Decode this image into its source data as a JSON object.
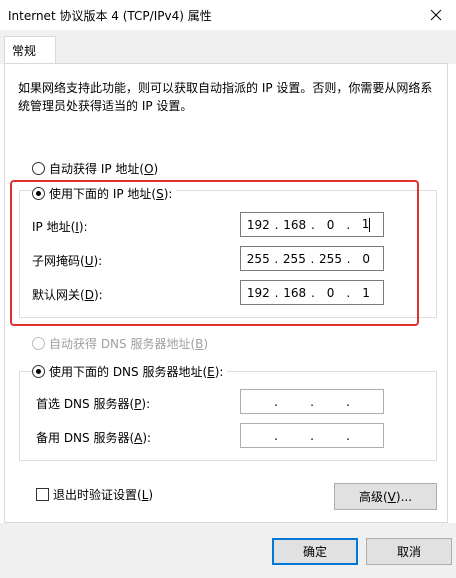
{
  "window": {
    "title": "Internet 协议版本 4 (TCP/IPv4) 属性"
  },
  "tabs": [
    {
      "label": "常规"
    }
  ],
  "description": "如果网络支持此功能，则可以获取自动指派的 IP 设置。否则，你需要从网络系统管理员处获得适当的 IP 设置。",
  "ip_section": {
    "auto_radio": {
      "label": "自动获得 IP 地址(",
      "key": "O",
      "suffix": ")",
      "checked": false
    },
    "manual_radio": {
      "label": "使用下面的 IP 地址(",
      "key": "S",
      "suffix": "):",
      "checked": true
    },
    "fields": [
      {
        "label": "IP 地址(",
        "key": "I",
        "suffix": "):",
        "octets": [
          "192",
          "168",
          "0",
          "1"
        ]
      },
      {
        "label": "子网掩码(",
        "key": "U",
        "suffix": "):",
        "octets": [
          "255",
          "255",
          "255",
          "0"
        ]
      },
      {
        "label": "默认网关(",
        "key": "D",
        "suffix": "):",
        "octets": [
          "192",
          "168",
          "0",
          "1"
        ]
      }
    ]
  },
  "dns_section": {
    "auto_radio": {
      "label": "自动获得 DNS 服务器地址(",
      "key": "B",
      "suffix": ")",
      "checked": false,
      "disabled": true
    },
    "manual_radio": {
      "label": "使用下面的 DNS 服务器地址(",
      "key": "E",
      "suffix": "):",
      "checked": true
    },
    "fields": [
      {
        "label": "首选 DNS 服务器(",
        "key": "P",
        "suffix": "):"
      },
      {
        "label": "备用 DNS 服务器(",
        "key": "A",
        "suffix": "):"
      }
    ],
    "ip_separator": "."
  },
  "validate_checkbox": {
    "label": "退出时验证设置(",
    "key": "L",
    "suffix": ")",
    "checked": false
  },
  "buttons": {
    "advanced": {
      "label": "高级(",
      "key": "V",
      "suffix": ")..."
    },
    "ok": {
      "label": "确定"
    },
    "cancel": {
      "label": "取消"
    }
  },
  "colors": {
    "highlight_frame": "#e0322d",
    "default_button_border": "#0078d7"
  }
}
